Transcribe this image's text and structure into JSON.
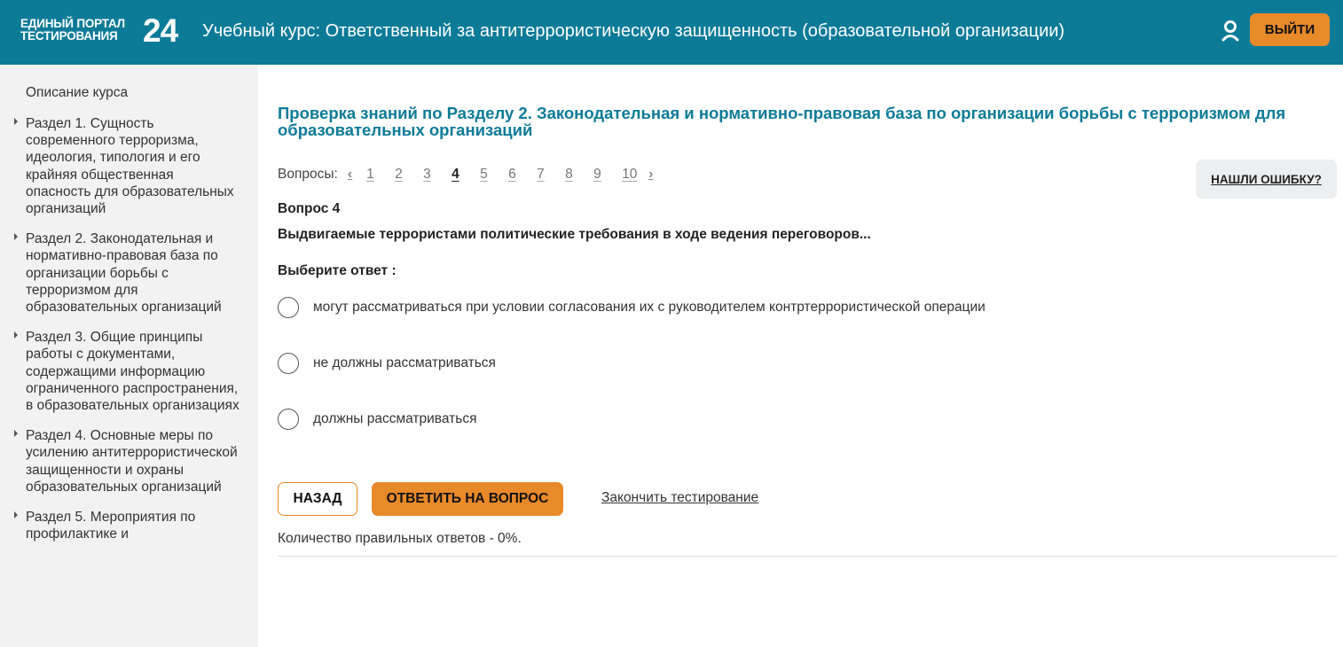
{
  "header": {
    "logo_line1": "ЕДИНЫЙ ПОРТАЛ",
    "logo_line2": "ТЕСТИРОВАНИЯ",
    "logo_number": "24",
    "course_title": "Учебный курс: Ответственный за антитеррористическую защищенность (образовательной организации)",
    "user_icon": "user-icon",
    "logout_label": "ВЫЙТИ"
  },
  "sidebar": {
    "description_label": "Описание курса",
    "items": [
      {
        "label": "Раздел 1. Сущность современного терроризма, идеология, типология и его крайняя общественная опасность для образовательных организаций"
      },
      {
        "label": "Раздел 2. Законодательная и нормативно-правовая база по организации борьбы с терроризмом для образовательных организаций"
      },
      {
        "label": "Раздел 3. Общие принципы работы с документами, содержащими информацию ограниченного распространения, в образовательных организациях"
      },
      {
        "label": "Раздел 4. Основные меры по усилению антитеррористической защищенности и охраны образовательных организаций"
      },
      {
        "label": "Раздел 5. Мероприятия по профилактике и"
      }
    ]
  },
  "main": {
    "test_title": "Проверка знаний по Разделу 2. Законодательная и нормативно-правовая база по организации борьбы с терроризмом для образовательных организаций",
    "questions_label": "Вопросы:",
    "prev_arrow": "‹",
    "next_arrow": "›",
    "question_numbers": [
      "1",
      "2",
      "3",
      "4",
      "5",
      "6",
      "7",
      "8",
      "9",
      "10"
    ],
    "active_question": "4",
    "report_error_label": "НАШЛИ ОШИБКУ?",
    "question_heading": "Вопрос 4",
    "question_text": "Выдвигаемые террористами политические требования в ходе ведения переговоров...",
    "choose_label": "Выберите ответ :",
    "options": [
      {
        "text": "могут рассматриваться при условии согласования их с руководителем контртеррористической операции"
      },
      {
        "text": "не должны рассматриваться"
      },
      {
        "text": "должны рассматриваться"
      }
    ],
    "back_label": "НАЗАД",
    "answer_label": "ОТВЕТИТЬ НА ВОПРОС",
    "finish_label": "Закончить тестирование",
    "result_text": "Количество правильных ответов - 0%."
  },
  "colors": {
    "header_bg": "#0c7b98",
    "accent_orange": "#e8892a",
    "title_blue": "#0c7b98",
    "sidebar_bg": "#f2f2f2"
  }
}
